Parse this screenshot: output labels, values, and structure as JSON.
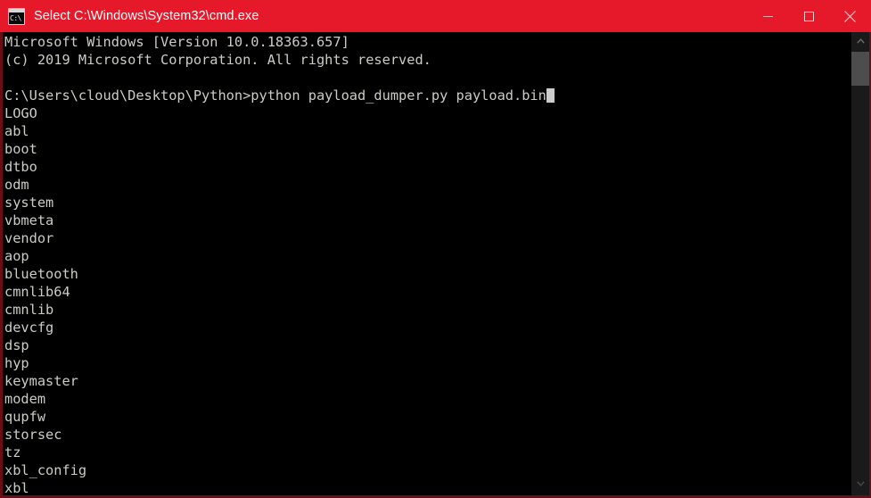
{
  "window": {
    "title": "Select C:\\Windows\\System32\\cmd.exe",
    "icon_name": "cmd-console-icon",
    "icon_text": "C:\\",
    "titlebar_color": "#e6192a",
    "border_color": "#6b0d16",
    "background_color": "#000000",
    "text_color": "#ccccc7"
  },
  "controls": {
    "minimize_label": "Minimize",
    "maximize_label": "Maximize",
    "close_label": "Close"
  },
  "console": {
    "lines": [
      "Microsoft Windows [Version 10.0.18363.657]",
      "(c) 2019 Microsoft Corporation. All rights reserved.",
      "",
      "C:\\Users\\cloud\\Desktop\\Python>python payload_dumper.py payload.bin",
      "LOGO",
      "abl",
      "boot",
      "dtbo",
      "odm",
      "system",
      "vbmeta",
      "vendor",
      "aop",
      "bluetooth",
      "cmnlib64",
      "cmnlib",
      "devcfg",
      "dsp",
      "hyp",
      "keymaster",
      "modem",
      "qupfw",
      "storsec",
      "tz",
      "xbl_config",
      "xbl"
    ],
    "prompt_line_index": 3,
    "cursor_line_index": 3,
    "cursor_char": "block"
  },
  "scrollbar": {
    "up_arrow_name": "scroll-up-arrow",
    "down_arrow_name": "scroll-down-arrow",
    "thumb_name": "scrollbar-thumb",
    "track_color": "#1a1a1a",
    "thumb_color": "#4d4d4d"
  }
}
